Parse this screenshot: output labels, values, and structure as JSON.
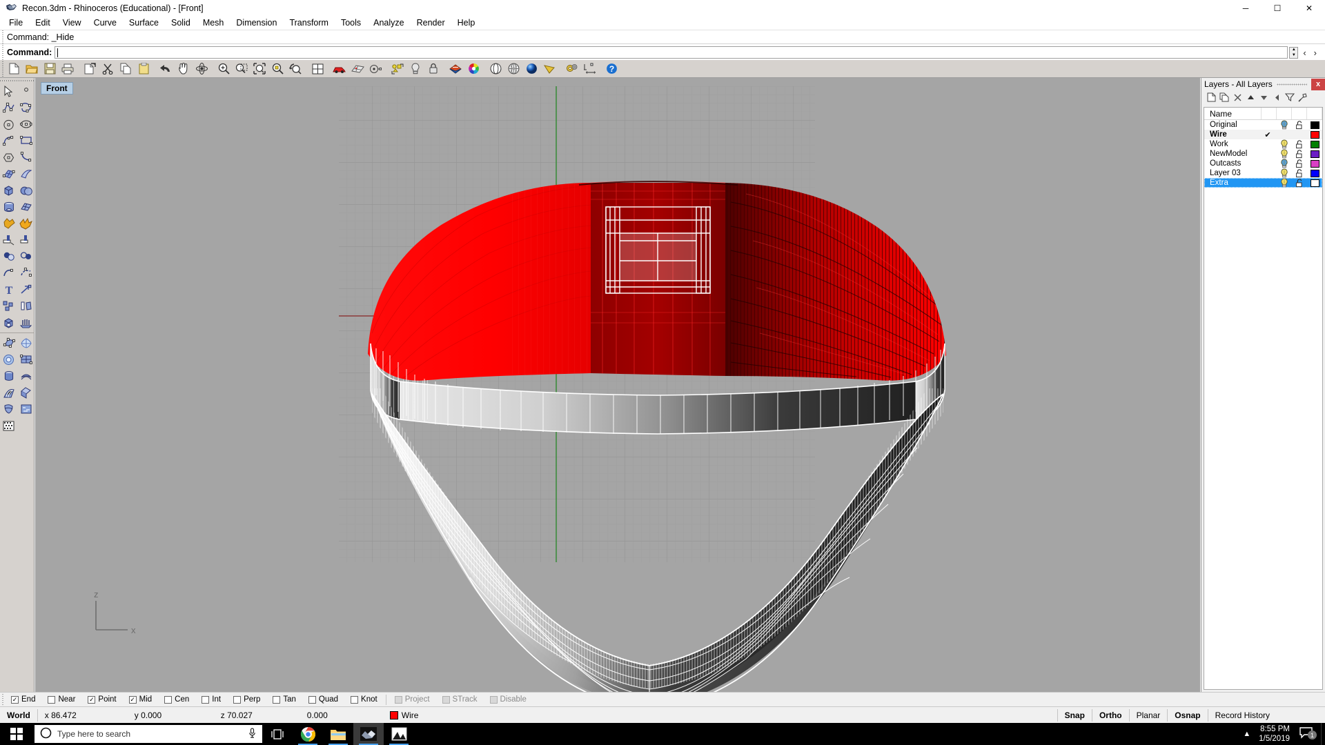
{
  "window": {
    "title": "Recon.3dm - Rhinoceros (Educational) - [Front]",
    "app_icon": "rhino-logo-icon",
    "minimize": "─",
    "maximize": "☐",
    "close": "✕"
  },
  "menubar": {
    "items": [
      {
        "label": "File"
      },
      {
        "label": "Edit"
      },
      {
        "label": "View"
      },
      {
        "label": "Curve"
      },
      {
        "label": "Surface"
      },
      {
        "label": "Solid"
      },
      {
        "label": "Mesh"
      },
      {
        "label": "Dimension"
      },
      {
        "label": "Transform"
      },
      {
        "label": "Tools"
      },
      {
        "label": "Analyze"
      },
      {
        "label": "Render"
      },
      {
        "label": "Help"
      }
    ]
  },
  "command": {
    "history": "Command: _Hide",
    "prompt_label": "Command:",
    "input_value": "",
    "input_placeholder": "",
    "nav_prev": "‹",
    "nav_next": "›"
  },
  "main_toolbar": {
    "buttons": [
      {
        "name": "new-file-icon",
        "title": "New"
      },
      {
        "name": "open-file-icon",
        "title": "Open"
      },
      {
        "name": "save-file-icon",
        "title": "Save"
      },
      {
        "name": "print-icon",
        "title": "Print"
      },
      {
        "name": "cut-copy-paste-group-icon",
        "title": "Copy to clipboard"
      },
      {
        "name": "scissors-cut-icon",
        "title": "Cut"
      },
      {
        "name": "copy-icon",
        "title": "Copy"
      },
      {
        "name": "paste-clipboard-icon",
        "title": "Paste"
      },
      {
        "name": "undo-arrow-icon",
        "title": "Undo"
      },
      {
        "name": "pan-hand-icon",
        "title": "Pan"
      },
      {
        "name": "rotate-view-icon",
        "title": "Rotate view"
      },
      {
        "name": "zoom-in-icon",
        "title": "Zoom in"
      },
      {
        "name": "zoom-window-icon",
        "title": "Zoom window"
      },
      {
        "name": "zoom-extents-icon",
        "title": "Zoom extents"
      },
      {
        "name": "zoom-selected-icon",
        "title": "Zoom selected"
      },
      {
        "name": "zoom-previous-icon",
        "title": "Zoom previous"
      },
      {
        "name": "viewport-layout-icon",
        "title": "Viewport layout"
      },
      {
        "name": "car-render-icon",
        "title": "Render"
      },
      {
        "name": "mesh-grid-icon",
        "title": "Mesh"
      },
      {
        "name": "point-object-icon",
        "title": "Points on"
      },
      {
        "name": "select-objects-icon",
        "title": "Select objects"
      },
      {
        "name": "light-bulb-icon",
        "title": "Layer visibility"
      },
      {
        "name": "padlock-icon",
        "title": "Lock layer"
      },
      {
        "name": "layer-color-icon",
        "title": "Layers"
      },
      {
        "name": "color-wheel-icon",
        "title": "Object color"
      },
      {
        "name": "shade-sphere-icon",
        "title": "Shade"
      },
      {
        "name": "ghosted-sphere-icon",
        "title": "Ghosted view"
      },
      {
        "name": "rendered-sphere-icon",
        "title": "Rendered view"
      },
      {
        "name": "flat-shade-icon",
        "title": "Flat shade"
      },
      {
        "name": "options-gears-icon",
        "title": "Options"
      },
      {
        "name": "dimension-icon",
        "title": "Dimension"
      },
      {
        "name": "help-icon",
        "title": "Help"
      }
    ]
  },
  "sidebar": {
    "buttons": [
      {
        "name": "select-arrow-icon"
      },
      {
        "name": "point-icon"
      },
      {
        "name": "polyline-icon"
      },
      {
        "name": "curve-interpolate-icon"
      },
      {
        "name": "circle-icon"
      },
      {
        "name": "ellipse-icon"
      },
      {
        "name": "arc-icon"
      },
      {
        "name": "rectangle-icon"
      },
      {
        "name": "polygon-icon"
      },
      {
        "name": "curve-blend-icon"
      },
      {
        "name": "surface-from-curves-icon"
      },
      {
        "name": "surface-loft-icon"
      },
      {
        "name": "box-solid-icon"
      },
      {
        "name": "sphere-boolean-icon"
      },
      {
        "name": "cylinder-icon"
      },
      {
        "name": "mesh-plane-icon"
      },
      {
        "name": "boolean-union-icon"
      },
      {
        "name": "explode-icon"
      },
      {
        "name": "trim-icon"
      },
      {
        "name": "split-icon"
      },
      {
        "name": "fillet-corner-icon"
      },
      {
        "name": "offset-icon"
      },
      {
        "name": "curve-extend-icon"
      },
      {
        "name": "curve-from-object-icon"
      },
      {
        "name": "text-object-icon"
      },
      {
        "name": "move-icon"
      },
      {
        "name": "group-icon"
      },
      {
        "name": "mirror-icon"
      },
      {
        "name": "cap-planar-holes-icon"
      },
      {
        "name": "extrude-icon"
      },
      {
        "name": "control-points-icon"
      },
      {
        "name": "rebuild-surface-icon"
      },
      {
        "name": "blend-surface-icon"
      },
      {
        "name": "surface-grid-icon"
      },
      {
        "name": "revolve-icon"
      },
      {
        "name": "sweep-1-rail-icon"
      },
      {
        "name": "sweep-2-rail-icon"
      },
      {
        "name": "patch-icon"
      },
      {
        "name": "drape-icon"
      },
      {
        "name": "heightfield-icon"
      },
      {
        "name": "mesh-from-surface-icon"
      }
    ]
  },
  "viewport": {
    "title": "Front",
    "background_color": "#a5a5a5",
    "grid_color": "#9b9b9b",
    "axis_x_color": "#8c3a3a",
    "axis_z_color": "#3a8c3a",
    "axis_labels": {
      "vertical": "z",
      "horizontal": "x"
    },
    "model": {
      "name": "helmet-wireframe-model",
      "shell_color": "#ff0000",
      "wire_color": "#ffffff",
      "description": "Red shaded helmet shell with white wireframe visor and brim"
    }
  },
  "layers_panel": {
    "title": "Layers - All Layers",
    "close_label": "x",
    "toolbar": [
      {
        "name": "new-layer-icon"
      },
      {
        "name": "duplicate-layer-icon"
      },
      {
        "name": "delete-layer-icon"
      },
      {
        "name": "move-layer-up-icon"
      },
      {
        "name": "move-layer-down-icon"
      },
      {
        "name": "previous-layer-icon"
      },
      {
        "name": "filter-layers-icon"
      },
      {
        "name": "layer-tools-icon"
      }
    ],
    "columns": [
      "Name",
      "",
      "",
      "",
      ""
    ],
    "rows": [
      {
        "name": "Original",
        "current": false,
        "check": "",
        "bulb": "on-blue",
        "bulb_color": "#5a9fd4",
        "lock": "unlocked",
        "color": "#000000",
        "selected": false,
        "bold": false
      },
      {
        "name": "Wire",
        "current": true,
        "check": "✔",
        "bulb": "none",
        "bulb_color": "",
        "lock": "none",
        "color": "#ff0000",
        "selected": false,
        "bold": true
      },
      {
        "name": "Work",
        "current": false,
        "check": "",
        "bulb": "on-yellow",
        "bulb_color": "#f2e06a",
        "lock": "unlocked",
        "color": "#007f00",
        "selected": false,
        "bold": false
      },
      {
        "name": "NewModel",
        "current": false,
        "check": "",
        "bulb": "on-yellow",
        "bulb_color": "#f2e06a",
        "lock": "unlocked",
        "color": "#6b1fc4",
        "selected": false,
        "bold": false
      },
      {
        "name": "Outcasts",
        "current": false,
        "check": "",
        "bulb": "on-blue",
        "bulb_color": "#5a9fd4",
        "lock": "unlocked",
        "color": "#d93fc4",
        "selected": false,
        "bold": false
      },
      {
        "name": "Layer 03",
        "current": false,
        "check": "",
        "bulb": "on-yellow",
        "bulb_color": "#f2e06a",
        "lock": "unlocked",
        "color": "#0000ff",
        "selected": false,
        "bold": false
      },
      {
        "name": "Extra",
        "current": false,
        "check": "",
        "bulb": "on-yellow",
        "bulb_color": "#f2e06a",
        "lock": "unlocked",
        "color": "#ffffff",
        "selected": true,
        "bold": false
      }
    ]
  },
  "osnap_bar": {
    "items": [
      {
        "label": "End",
        "checked": true,
        "enabled": true
      },
      {
        "label": "Near",
        "checked": false,
        "enabled": true
      },
      {
        "label": "Point",
        "checked": true,
        "enabled": true
      },
      {
        "label": "Mid",
        "checked": true,
        "enabled": true
      },
      {
        "label": "Cen",
        "checked": false,
        "enabled": true
      },
      {
        "label": "Int",
        "checked": false,
        "enabled": true
      },
      {
        "label": "Perp",
        "checked": false,
        "enabled": true
      },
      {
        "label": "Tan",
        "checked": false,
        "enabled": true
      },
      {
        "label": "Quad",
        "checked": false,
        "enabled": true
      },
      {
        "label": "Knot",
        "checked": false,
        "enabled": true
      },
      {
        "label": "Project",
        "checked": false,
        "enabled": false
      },
      {
        "label": "STrack",
        "checked": false,
        "enabled": false
      },
      {
        "label": "Disable",
        "checked": false,
        "enabled": false
      }
    ]
  },
  "status_bar": {
    "cplane_label": "World",
    "coord_x": "x 86.472",
    "coord_y": "y 0.000",
    "coord_z": "z 70.027",
    "coord_extra": "0.000",
    "layer_name": "Wire",
    "layer_color": "#ff0000",
    "toggles": [
      {
        "label": "Snap",
        "active": true
      },
      {
        "label": "Ortho",
        "active": true
      },
      {
        "label": "Planar",
        "active": false
      },
      {
        "label": "Osnap",
        "active": true
      },
      {
        "label": "Record History",
        "active": false
      }
    ]
  },
  "taskbar": {
    "start_icon": "windows-start-icon",
    "search_icon": "cortana-circle-icon",
    "search_placeholder": "Type here to search",
    "mic_icon": "microphone-icon",
    "taskview_icon": "task-view-icon",
    "apps": [
      {
        "name": "chrome-icon",
        "label": "Google Chrome",
        "running": true,
        "active": false
      },
      {
        "name": "file-explorer-icon",
        "label": "File Explorer",
        "running": true,
        "active": false
      },
      {
        "name": "rhinoceros-icon",
        "label": "Rhinoceros",
        "running": true,
        "active": true
      },
      {
        "name": "photos-icon",
        "label": "Photos",
        "running": true,
        "active": false
      }
    ],
    "tray": {
      "show_hidden_icon": "chevron-up-icon",
      "time": "8:55 PM",
      "date": "1/5/2019",
      "notification_icon": "notification-speech-icon",
      "notification_count": "1"
    }
  }
}
